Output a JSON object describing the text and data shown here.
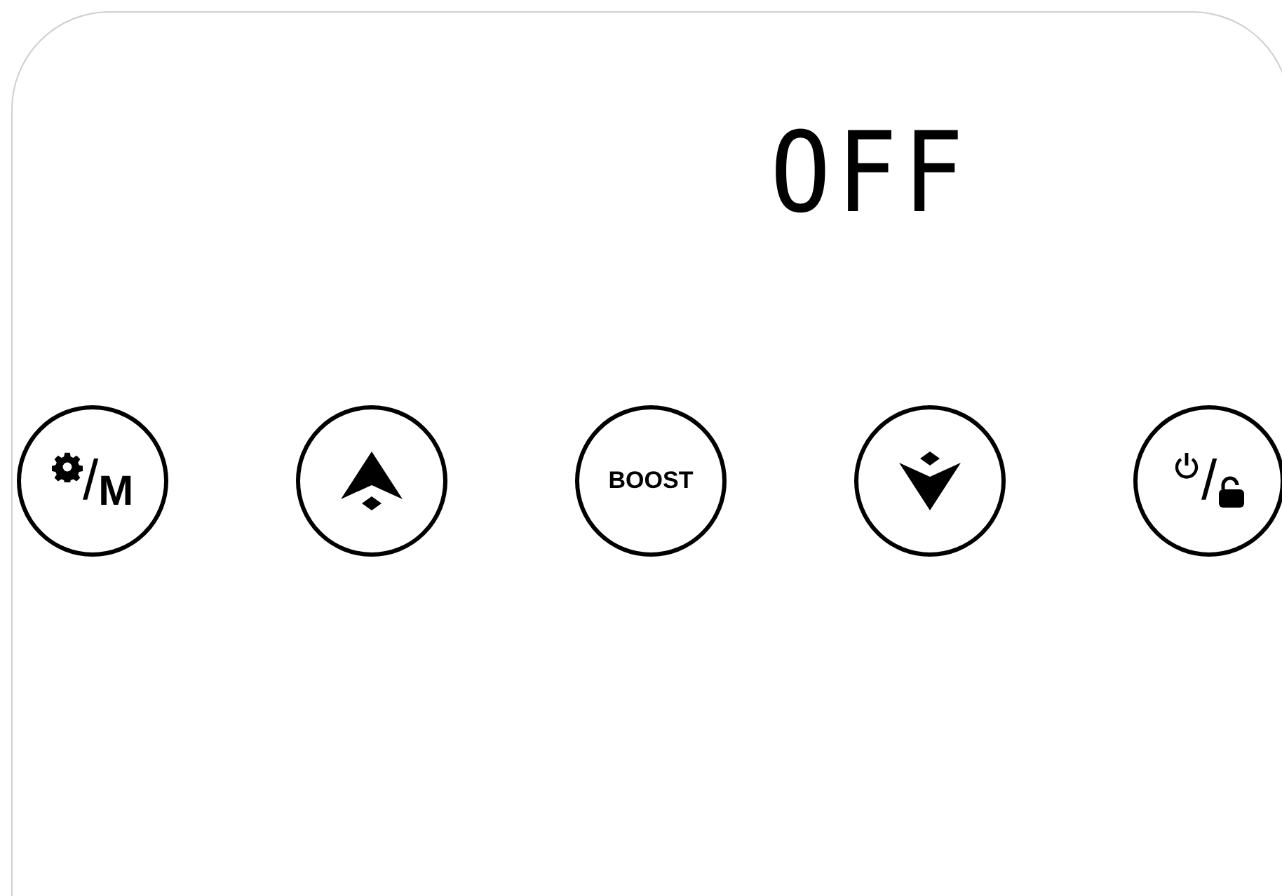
{
  "display": {
    "text": "OFF"
  },
  "buttons": [
    {
      "kind": "mode",
      "separator": "/",
      "label": "M"
    },
    {
      "kind": "up"
    },
    {
      "kind": "boost",
      "label": "BOOST"
    },
    {
      "kind": "down"
    },
    {
      "kind": "power-lock",
      "separator": "/"
    }
  ]
}
